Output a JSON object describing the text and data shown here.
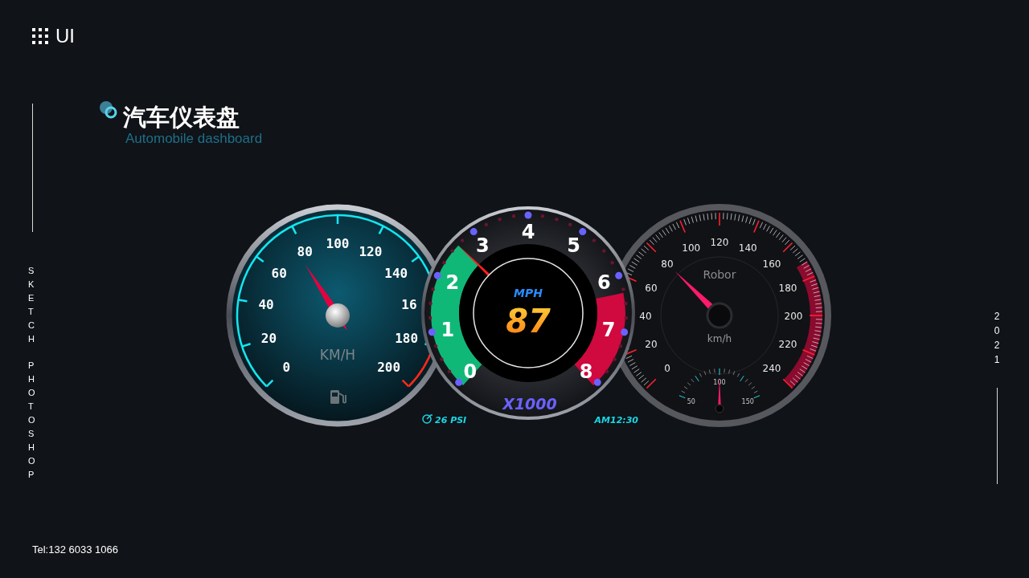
{
  "brand": {
    "label": "UI"
  },
  "title": "汽车仪表盘",
  "subtitle": "Automobile dashboard",
  "side_text": [
    "SKETCH",
    "PHOTOSHOP"
  ],
  "year": "2021",
  "contact": "Tel:132 6033 1066",
  "speedometer": {
    "labels": [
      "0",
      "20",
      "40",
      "60",
      "80",
      "100",
      "120",
      "140",
      "16",
      "180",
      "200"
    ],
    "unit": "KM/H",
    "level": 0.38
  },
  "tachometer": {
    "labels": [
      "0",
      "1",
      "2",
      "3",
      "4",
      "5",
      "6",
      "7",
      "8"
    ],
    "unit": "MPH",
    "reading": "87",
    "multiplier": "X1000",
    "level": 0.33,
    "boost": "26 PSI",
    "clock": "AM12:30"
  },
  "speedometer_2": {
    "brand": "Robor",
    "labels": [
      "0",
      "20",
      "40",
      "60",
      "80",
      "100",
      "120",
      "140",
      "160",
      "180",
      "200",
      "220",
      "240"
    ],
    "unit": "km/h",
    "level": 0.333,
    "sub_gauge": {
      "labels": [
        "50",
        "100",
        "150"
      ],
      "level": 0.5
    }
  }
}
